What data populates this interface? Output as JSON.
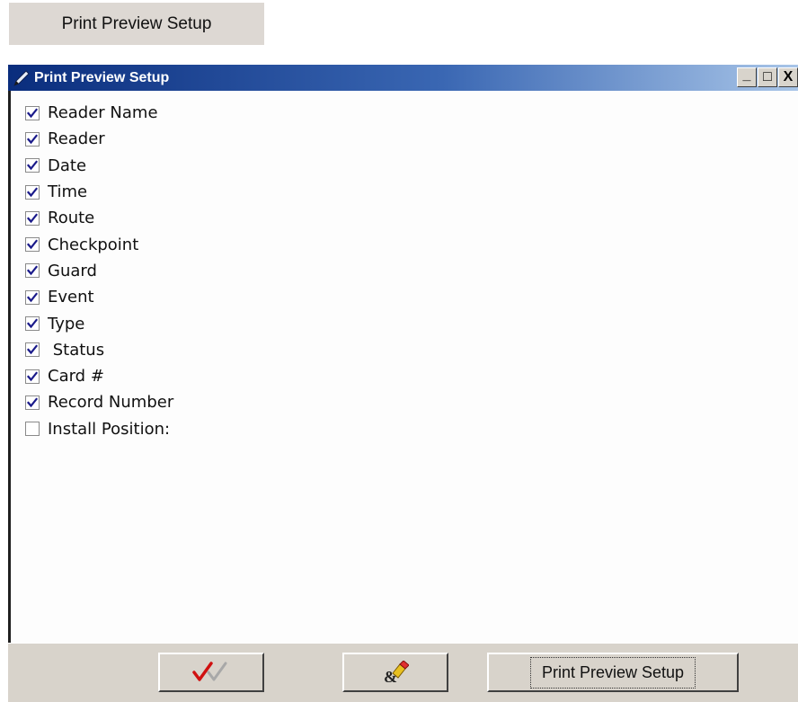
{
  "top_button": {
    "label": "Print Preview Setup"
  },
  "window": {
    "title": "Print Preview Setup",
    "controls": {
      "minimize": "_",
      "maximize": "□",
      "close": "X"
    }
  },
  "fields": [
    {
      "label": "Reader Name",
      "checked": true
    },
    {
      "label": "Reader",
      "checked": true
    },
    {
      "label": "Date",
      "checked": true
    },
    {
      "label": "Time",
      "checked": true
    },
    {
      "label": "Route",
      "checked": true
    },
    {
      "label": "Checkpoint",
      "checked": true
    },
    {
      "label": "Guard",
      "checked": true
    },
    {
      "label": "Event",
      "checked": true
    },
    {
      "label": "Type",
      "checked": true
    },
    {
      "label": " Status",
      "checked": true
    },
    {
      "label": "Card #",
      "checked": true
    },
    {
      "label": "Record Number",
      "checked": true
    },
    {
      "label": "Install Position:",
      "checked": false
    }
  ],
  "bottom_buttons": {
    "ok_icon": "double-checkmark-icon",
    "clear_icon": "eraser-icon",
    "print_label": "Print Preview Setup"
  },
  "colors": {
    "title_start": "#0a2d7d",
    "title_end": "#a8c5e8",
    "check": "#1a1a8a",
    "ok_red": "#d01010"
  }
}
